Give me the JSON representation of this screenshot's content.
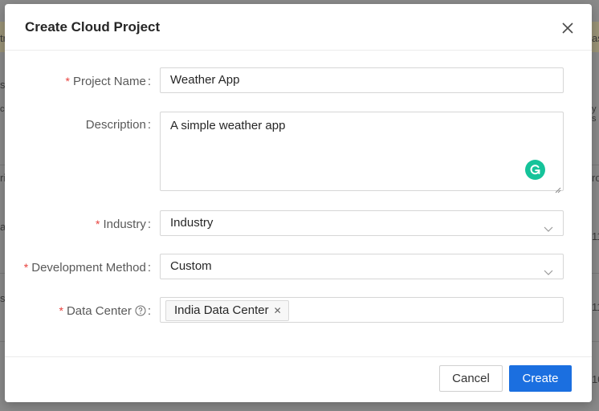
{
  "dialog": {
    "title": "Create Cloud Project",
    "fields": {
      "project_name": {
        "label": "Project Name",
        "value": "Weather App"
      },
      "description": {
        "label": "Description",
        "value": "A simple weather app"
      },
      "industry": {
        "label": "Industry",
        "value": "Industry"
      },
      "development_method": {
        "label": "Development Method",
        "value": "Custom"
      },
      "data_center": {
        "label": "Data Center",
        "tag": "India Data Center"
      }
    },
    "colon": ":",
    "required_mark": "*",
    "footer": {
      "cancel_label": "Cancel",
      "create_label": "Create"
    }
  },
  "background": {
    "fragments": [
      "tr",
      "s",
      "c",
      "ri",
      "a",
      "sa",
      "as",
      "y s",
      "ro",
      "11",
      "11",
      "10"
    ]
  },
  "colors": {
    "primary": "#1b6fe0",
    "required": "#e8413d",
    "grammarly": "#15c39a"
  }
}
